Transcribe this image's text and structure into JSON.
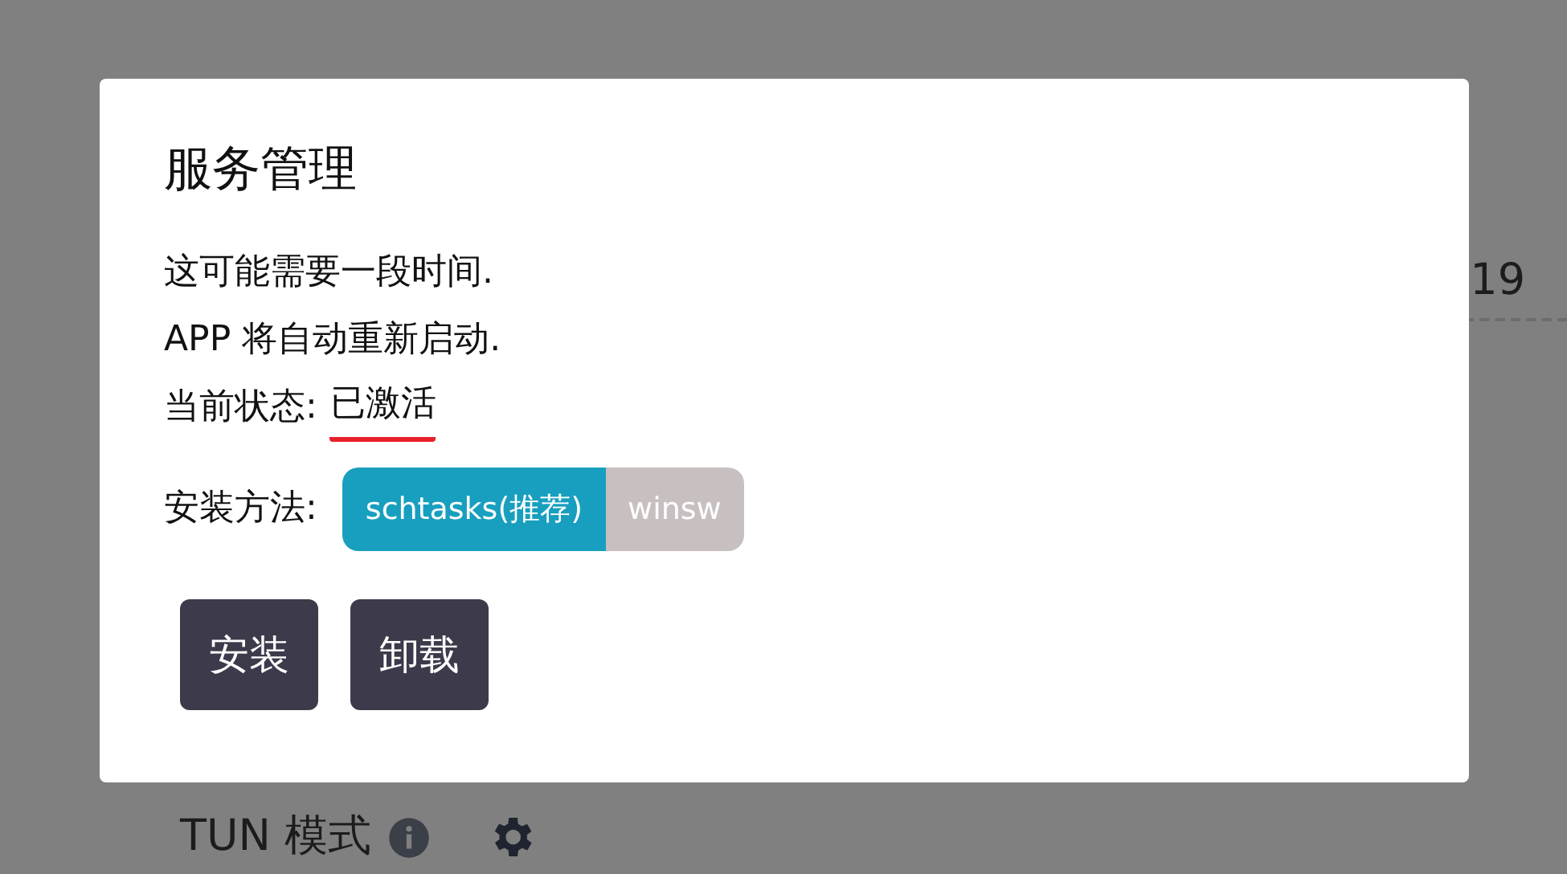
{
  "background": {
    "right_value": "19",
    "tun_label": "TUN 模式"
  },
  "dialog": {
    "title": "服务管理",
    "lines": [
      "这可能需要一段时间.",
      "APP 将自动重新启动."
    ],
    "status_label": "当前状态:",
    "status": "已激活",
    "method_label": "安装方法:",
    "methods": [
      {
        "label": "schtasks(推荐)",
        "selected": true
      },
      {
        "label": "winsw",
        "selected": false
      }
    ],
    "buttons": [
      "安装",
      "卸载"
    ]
  }
}
